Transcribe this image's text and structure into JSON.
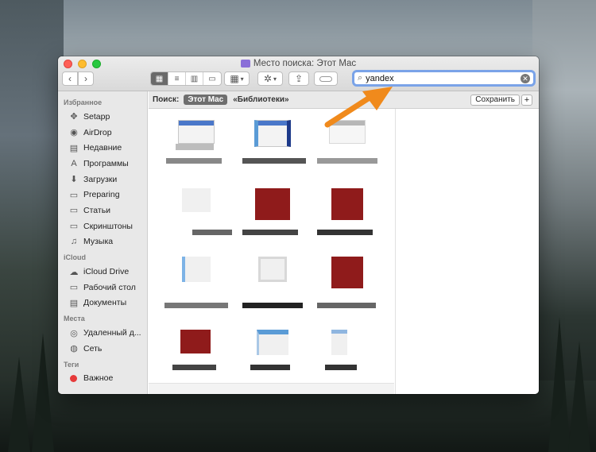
{
  "window": {
    "title": "Место поиска: Этот Mac"
  },
  "toolbar": {
    "back": "‹",
    "forward": "›",
    "search_value": "yandex"
  },
  "scope_bar": {
    "label": "Поиск:",
    "scope_active": "Этот Mac",
    "scope_other": "«Библиотеки»",
    "save": "Сохранить",
    "add": "+"
  },
  "sidebar": {
    "favorites_title": "Избранное",
    "favorites": [
      {
        "label": "Setapp",
        "icon": "setapp-icon"
      },
      {
        "label": "AirDrop",
        "icon": "airdrop-icon"
      },
      {
        "label": "Недавние",
        "icon": "recents-icon"
      },
      {
        "label": "Программы",
        "icon": "applications-icon"
      },
      {
        "label": "Загрузки",
        "icon": "downloads-icon"
      },
      {
        "label": "Preparing",
        "icon": "folder-icon"
      },
      {
        "label": "Статьи",
        "icon": "folder-icon"
      },
      {
        "label": "Скринштоны",
        "icon": "folder-icon"
      },
      {
        "label": "Музыка",
        "icon": "music-icon"
      }
    ],
    "icloud_title": "iCloud",
    "icloud": [
      {
        "label": "iCloud Drive",
        "icon": "icloud-icon"
      },
      {
        "label": "Рабочий стол",
        "icon": "desktop-icon"
      },
      {
        "label": "Документы",
        "icon": "documents-icon"
      }
    ],
    "places_title": "Места",
    "places": [
      {
        "label": "Удаленный д...",
        "icon": "remote-disc-icon"
      },
      {
        "label": "Сеть",
        "icon": "network-icon"
      }
    ],
    "tags_title": "Теги",
    "tags": [
      {
        "label": "Важное",
        "color": "#e63a3a"
      }
    ]
  },
  "accent": {
    "search_focus": "#7aa3e8",
    "arrow": "#f08a1c"
  }
}
